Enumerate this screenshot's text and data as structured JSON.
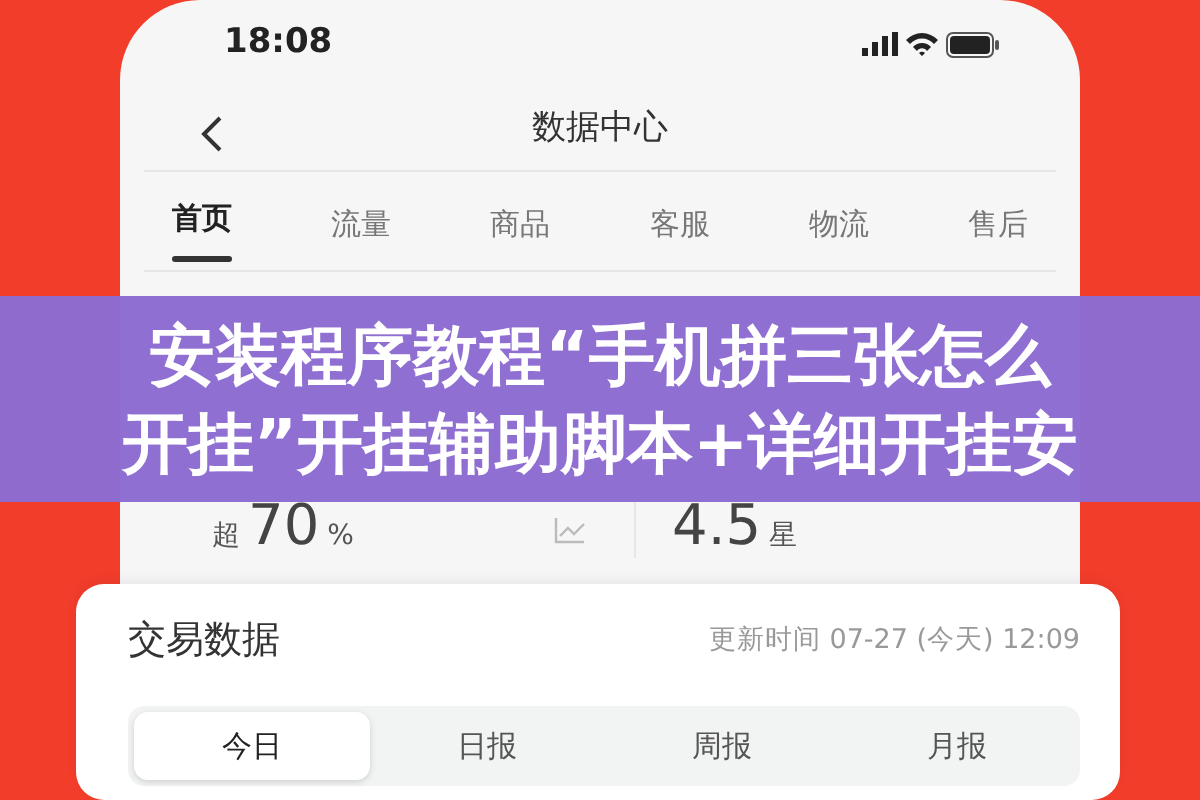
{
  "status_bar": {
    "time": "18:08"
  },
  "nav": {
    "title": "数据中心"
  },
  "tabs": [
    {
      "label": "首页",
      "selected": true
    },
    {
      "label": "流量",
      "selected": false
    },
    {
      "label": "商品",
      "selected": false
    },
    {
      "label": "客服",
      "selected": false
    },
    {
      "label": "物流",
      "selected": false
    },
    {
      "label": "售后",
      "selected": false
    }
  ],
  "store_stats": [
    {
      "prefix": "超",
      "value": "70",
      "unit": "%",
      "trend_icon": true
    },
    {
      "value": "4.5",
      "unit": "星",
      "trend_icon": false
    }
  ],
  "banner": {
    "lines": [
      "安装程序教程“手机拼三张怎么",
      "开挂”开挂辅助脚本+详细开挂安"
    ]
  },
  "trade_card": {
    "title": "交易数据",
    "updated": "更新时间 07-27 (今天) 12:09",
    "periods": [
      {
        "label": "今日",
        "selected": true
      },
      {
        "label": "日报",
        "selected": false
      },
      {
        "label": "周报",
        "selected": false
      },
      {
        "label": "月报",
        "selected": false
      }
    ]
  }
}
